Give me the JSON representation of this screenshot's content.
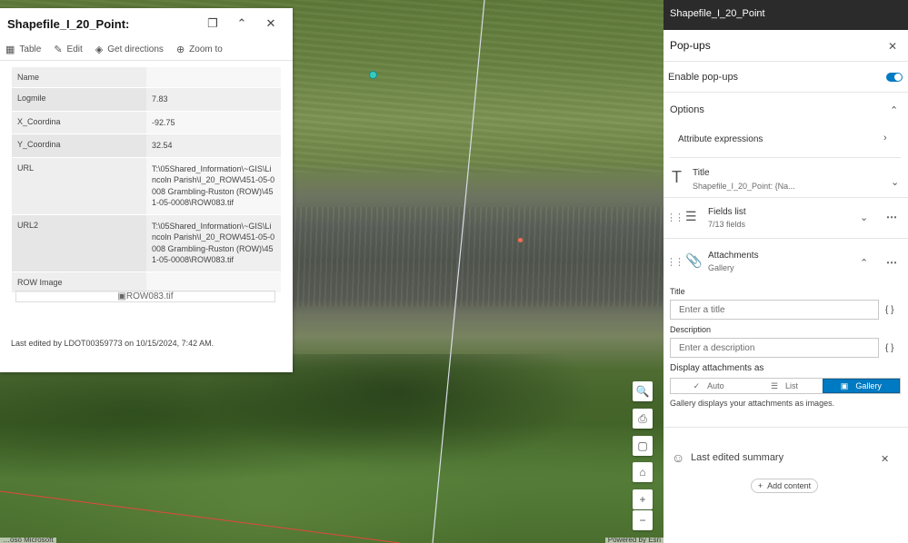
{
  "popup": {
    "title": "Shapefile_I_20_Point:",
    "actions": [
      {
        "label": "Table",
        "icon": "table-icon"
      },
      {
        "label": "Edit",
        "icon": "edit-icon"
      },
      {
        "label": "Get directions",
        "icon": "directions-icon"
      },
      {
        "label": "Zoom to",
        "icon": "zoom-to-icon"
      }
    ],
    "fields": [
      {
        "name": "Name",
        "value": ""
      },
      {
        "name": "Logmile",
        "value": "7.83"
      },
      {
        "name": "X_Coordina",
        "value": "-92.75"
      },
      {
        "name": "Y_Coordina",
        "value": "32.54"
      },
      {
        "name": "URL",
        "value": "T:\\05Shared_Information\\~GIS\\Lincoln Parish\\I_20_ROW\\451-05-0008 Grambling-Ruston (ROW)\\451-05-0008\\ROW083.tif"
      },
      {
        "name": "URL2",
        "value": "T:\\05Shared_Information\\~GIS\\Lincoln Parish\\I_20_ROW\\451-05-0008 Grambling-Ruston (ROW)\\451-05-0008\\ROW083.tif"
      },
      {
        "name": "ROW Image",
        "value": ""
      }
    ],
    "image_alt": "ROW083.tif",
    "last_edited": "Last edited by LDOT00359773 on 10/15/2024, 7:42 AM."
  },
  "map": {
    "attribution_left": "…oso Microsoft",
    "attribution_right": "Powered by Esri"
  },
  "panel": {
    "header": "Shapefile_I_20_Point",
    "section_title": "Pop-ups",
    "enable_popups_label": "Enable pop-ups",
    "enable_popups_value": true,
    "options_label": "Options",
    "attribute_expressions_label": "Attribute expressions",
    "title_block": {
      "label": "Title",
      "sub": "Shapefile_I_20_Point: {Na..."
    },
    "fields_block": {
      "label": "Fields list",
      "sub": "7/13 fields"
    },
    "attachments_block": {
      "label": "Attachments",
      "sub": "Gallery"
    },
    "att_title_label": "Title",
    "att_title_placeholder": "Enter a title",
    "att_desc_label": "Description",
    "att_desc_placeholder": "Enter a description",
    "display_as_label": "Display attachments as",
    "display_options": [
      "Auto",
      "List",
      "Gallery"
    ],
    "display_selected": "Gallery",
    "gallery_hint": "Gallery displays your attachments as images.",
    "last_edited_summary": "Last edited summary",
    "add_content": "Add content",
    "curly": "{ }"
  },
  "colors": {
    "accent": "#007ac2",
    "topbar": "#2b2b2b"
  }
}
